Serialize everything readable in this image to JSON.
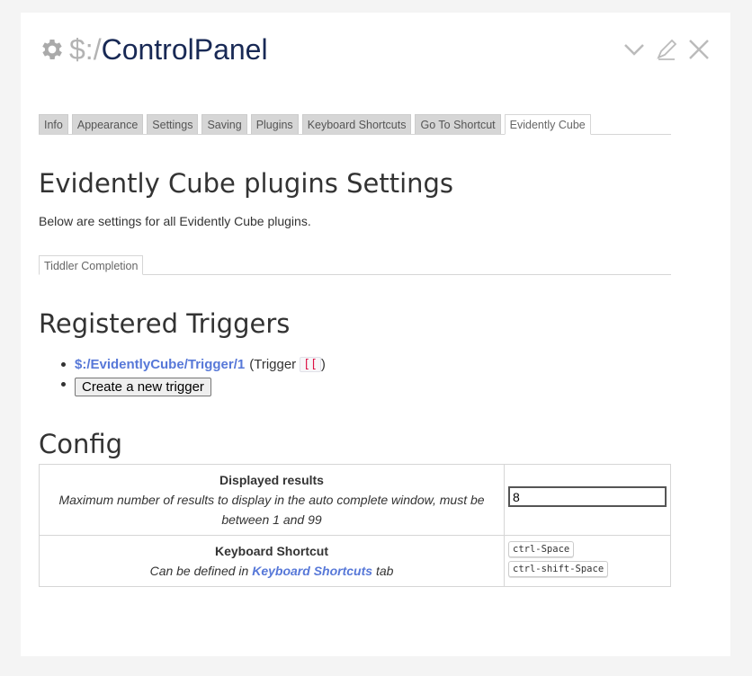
{
  "window": {
    "title_prefix": "$:/",
    "title_main": "ControlPanel"
  },
  "controls": [
    "chevron-down-icon",
    "edit-icon",
    "close-icon"
  ],
  "tabs": [
    {
      "label": "Info"
    },
    {
      "label": "Appearance"
    },
    {
      "label": "Settings"
    },
    {
      "label": "Saving"
    },
    {
      "label": "Plugins"
    },
    {
      "label": "Keyboard Shortcuts"
    },
    {
      "label": "Go To Shortcut"
    },
    {
      "label": "Evidently Cube",
      "active": true
    }
  ],
  "settings": {
    "heading": "Evidently Cube plugins Settings",
    "description": "Below are settings for all Evidently Cube plugins.",
    "subtab": "Tiddler Completion"
  },
  "triggers": {
    "heading": "Registered Triggers",
    "items": [
      {
        "link": "$:/EvidentlyCube/Trigger/1",
        "prefix": "(Trigger",
        "code": "[[",
        "suffix": ")"
      }
    ],
    "create_button": "Create a new trigger"
  },
  "config": {
    "heading": "Config",
    "rows": [
      {
        "title": "Displayed results",
        "description": "Maximum number of results to display in the auto complete window, must be between 1 and 99",
        "value": "8"
      },
      {
        "title": "Keyboard Shortcut",
        "desc_pre": "Can be defined in",
        "desc_link": "Keyboard Shortcuts",
        "desc_post": "tab",
        "shortcuts": [
          "ctrl-Space",
          "ctrl-shift-Space"
        ]
      }
    ]
  }
}
